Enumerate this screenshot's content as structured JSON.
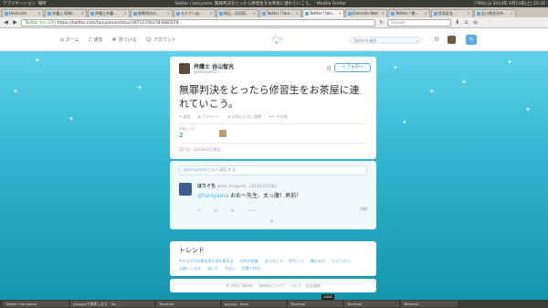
{
  "os": {
    "apps_menu": "アプリケーション",
    "places_menu": "場所",
    "window_title": "Twitter / taniyama: 無罪判決をとったら修習生をお茶屋に連れていこう。 - Mozilla Firefox",
    "status_right": "(78%)   ja   2014年 6月14日(土) 22:33"
  },
  "browser": {
    "tabs": [
      {
        "label": "Hootsuite"
      },
      {
        "label": "弁護士 昭和(..."
      },
      {
        "label": "弁理士弁護..."
      },
      {
        "label": "無罪判決の..."
      },
      {
        "label": "モキアン@..."
      },
      {
        "label": "吹石…谷沢局..."
      },
      {
        "label": "Twitter / tani..."
      },
      {
        "label": "Twitter / tan..."
      },
      {
        "label": "Evernote Web"
      },
      {
        "label": "Twitter / 検..."
      },
      {
        "label": "伏見区金..."
      },
      {
        "label": "石川県金沢市..."
      }
    ],
    "url_domain": "Twitter Inc (US)",
    "url_path": "https://twitter.com/taniyama/status/397117003783980178",
    "search_placeholder": "Google"
  },
  "twitter": {
    "nav_home": "ホーム",
    "nav_notifications": "通知",
    "nav_discover": "見つける",
    "nav_account": "アカウント",
    "search_placeholder": "Twitterを検索",
    "tweet": {
      "name": "弁護士 谷山智光",
      "screen_name": "@taniyama",
      "follow": "フォロー",
      "text": "無罪判決をとったら修習生をお茶屋に連れていこう。",
      "actions": [
        "返信",
        "リツイート",
        "お気に入りに登録",
        "その他"
      ],
      "favorites_label": "お気に入り",
      "favorites_count": "2",
      "timestamp": "22:16 - 2013年2月28日"
    },
    "reply_box": {
      "mention": "@taniyama",
      "suffix": "さんへ返信する"
    },
    "reply": {
      "name": "ほりぐち",
      "screen_name": "@mis_horiguchi · 2013年2月28日",
      "mention": "@taniyama",
      "text": " おお～先生、太っ腹！男前！",
      "details": "詳細"
    },
    "trends": {
      "title": "トレンド",
      "items": [
        "#ホモの不祥事を隠す為を意見は",
        "AAAの前後",
        "ありがとう",
        "Bfモード",
        "俺のまた",
        "さようなら",
        "お願いします",
        "描いて",
        "やばい",
        "定番と特別"
      ]
    },
    "footer": [
      "© 2014 Twitter",
      "Twitterについて",
      "ヘルプ",
      "広告情報"
    ]
  },
  "taskbar": {
    "items": [
      "Twitter / taniyama",
      "[Googleで検索します - Tw...",
      "Terminal",
      "gg-cap - Kaku",
      "Terminal",
      "Terminal",
      "Terminal"
    ],
    "tooltip": "XXXX"
  },
  "colors": {
    "accent": "#55acee",
    "bg_top": "#5fd1e8",
    "bg_bottom": "#1396ad"
  }
}
